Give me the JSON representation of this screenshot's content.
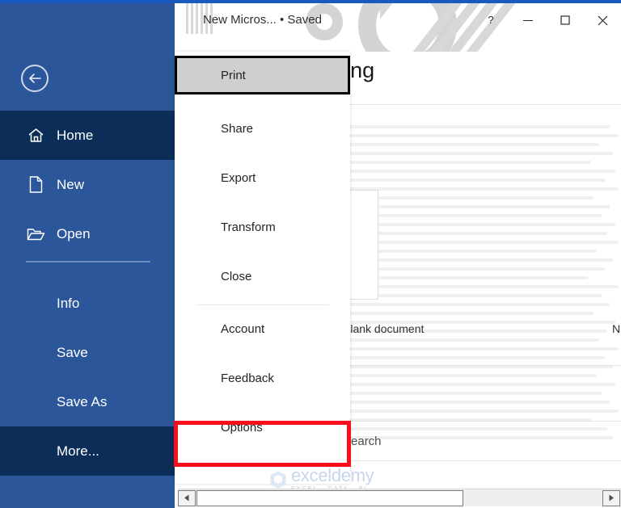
{
  "window": {
    "document_title": "New Micros... • Saved",
    "controls": [
      {
        "name": "help-button",
        "glyph": "?"
      },
      {
        "name": "minimize-button",
        "glyph": "—"
      },
      {
        "name": "maximize-button",
        "glyph": "□"
      },
      {
        "name": "close-button",
        "glyph": "✕"
      }
    ]
  },
  "page": {
    "greeting": "Good morning",
    "blank_document_label": "Blank document",
    "second_template_label": "N",
    "search_label": "Search"
  },
  "sidebar": {
    "back_label": "Back",
    "items": [
      {
        "label": "Home",
        "icon": "home-icon",
        "active": true,
        "has_icon": true
      },
      {
        "label": "New",
        "icon": "new-document-icon",
        "active": false,
        "has_icon": true
      },
      {
        "label": "Open",
        "icon": "open-folder-icon",
        "active": false,
        "has_icon": true
      },
      {
        "label": "Info",
        "icon": "",
        "active": false,
        "has_icon": false
      },
      {
        "label": "Save",
        "icon": "",
        "active": false,
        "has_icon": false
      },
      {
        "label": "Save As",
        "icon": "",
        "active": false,
        "has_icon": false
      },
      {
        "label": "More...",
        "icon": "",
        "active": true,
        "has_icon": false
      }
    ]
  },
  "menu": {
    "items": [
      {
        "label": "Print",
        "selected": true
      },
      {
        "label": "Share",
        "selected": false
      },
      {
        "label": "Export",
        "selected": false
      },
      {
        "label": "Transform",
        "selected": false
      },
      {
        "label": "Close",
        "selected": false
      },
      {
        "label": "Account",
        "selected": false
      },
      {
        "label": "Feedback",
        "selected": false
      },
      {
        "label": "Options",
        "selected": false
      }
    ],
    "highlighted_item": "Options"
  },
  "watermark": {
    "name": "exceldemy",
    "tagline": "EXCEL · DATA · BI"
  },
  "colors": {
    "rail_blue": "#2b579a",
    "rail_active": "#0c2d57",
    "title_strip": "#185abd",
    "callout_red": "#fc0d1b",
    "selected_gray": "#cfcfcf"
  }
}
